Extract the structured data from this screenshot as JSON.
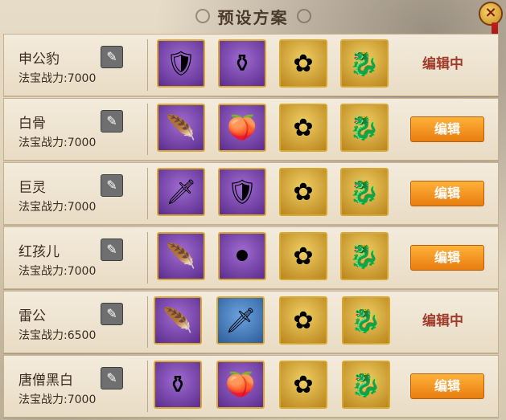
{
  "header": {
    "title": "预设方案"
  },
  "close_icon": "close-icon",
  "rows": [
    {
      "name": "申公豹",
      "power": "法宝战力:7000",
      "slots": [
        "purple",
        "purple",
        "gold",
        "gold"
      ],
      "status": "编辑中",
      "button": ""
    },
    {
      "name": "白骨",
      "power": "法宝战力:7000",
      "slots": [
        "purple",
        "purple",
        "gold",
        "gold"
      ],
      "status": "",
      "button": "编辑"
    },
    {
      "name": "巨灵",
      "power": "法宝战力:7000",
      "slots": [
        "purple",
        "purple",
        "gold",
        "gold"
      ],
      "status": "",
      "button": "编辑"
    },
    {
      "name": "红孩儿",
      "power": "法宝战力:7000",
      "slots": [
        "purple",
        "purple",
        "gold",
        "gold"
      ],
      "status": "",
      "button": "编辑"
    },
    {
      "name": "雷公",
      "power": "法宝战力:6500",
      "slots": [
        "purple",
        "blue",
        "gold",
        "gold"
      ],
      "status": "编辑中",
      "button": ""
    },
    {
      "name": "唐僧黑白",
      "power": "法宝战力:7000",
      "slots": [
        "purple",
        "purple",
        "gold",
        "gold"
      ],
      "status": "",
      "button": "编辑"
    }
  ]
}
